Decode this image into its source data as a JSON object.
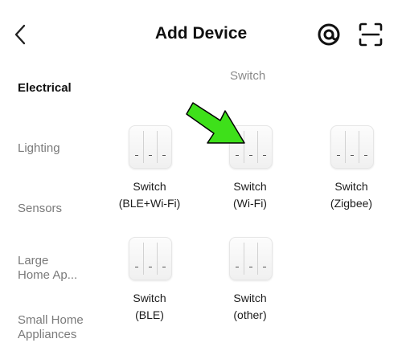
{
  "header": {
    "title": "Add Device"
  },
  "sidebar": {
    "items": [
      {
        "label_lines": [
          "Electrical"
        ],
        "active": true
      },
      {
        "label_lines": [
          "Lighting"
        ],
        "active": false
      },
      {
        "label_lines": [
          "Sensors"
        ],
        "active": false
      },
      {
        "label_lines": [
          "Large",
          "Home Ap..."
        ],
        "active": false
      },
      {
        "label_lines": [
          "Small Home",
          "Appliances"
        ],
        "active": false
      }
    ]
  },
  "main": {
    "section_title": "Switch",
    "devices": [
      {
        "name": "Switch",
        "protocol": "(BLE+Wi-Fi)"
      },
      {
        "name": "Switch",
        "protocol": "(Wi-Fi)"
      },
      {
        "name": "Switch",
        "protocol": "(Zigbee)"
      },
      {
        "name": "Switch",
        "protocol": "(BLE)"
      },
      {
        "name": "Switch",
        "protocol": "(other)"
      }
    ]
  },
  "colors": {
    "accent_arrow": "#3ee01a",
    "text_active": "#111111",
    "text_inactive": "#7a7a7a"
  }
}
